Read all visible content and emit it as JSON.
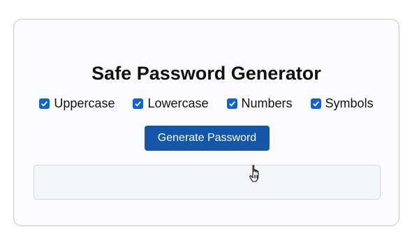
{
  "app": {
    "title": "Safe Password Generator"
  },
  "options": [
    {
      "label": "Uppercase",
      "checked": true
    },
    {
      "label": "Lowercase",
      "checked": true
    },
    {
      "label": "Numbers",
      "checked": true
    },
    {
      "label": "Symbols",
      "checked": true
    }
  ],
  "generate_button": {
    "label": "Generate Password"
  },
  "output": {
    "value": ""
  },
  "colors": {
    "accent": "#1656a8",
    "checkbox": "#0b64d8",
    "output_bg": "#f3f5f7"
  },
  "icons": {
    "checkbox": "checkmark-icon",
    "cursor": "hand-pointer-icon"
  }
}
